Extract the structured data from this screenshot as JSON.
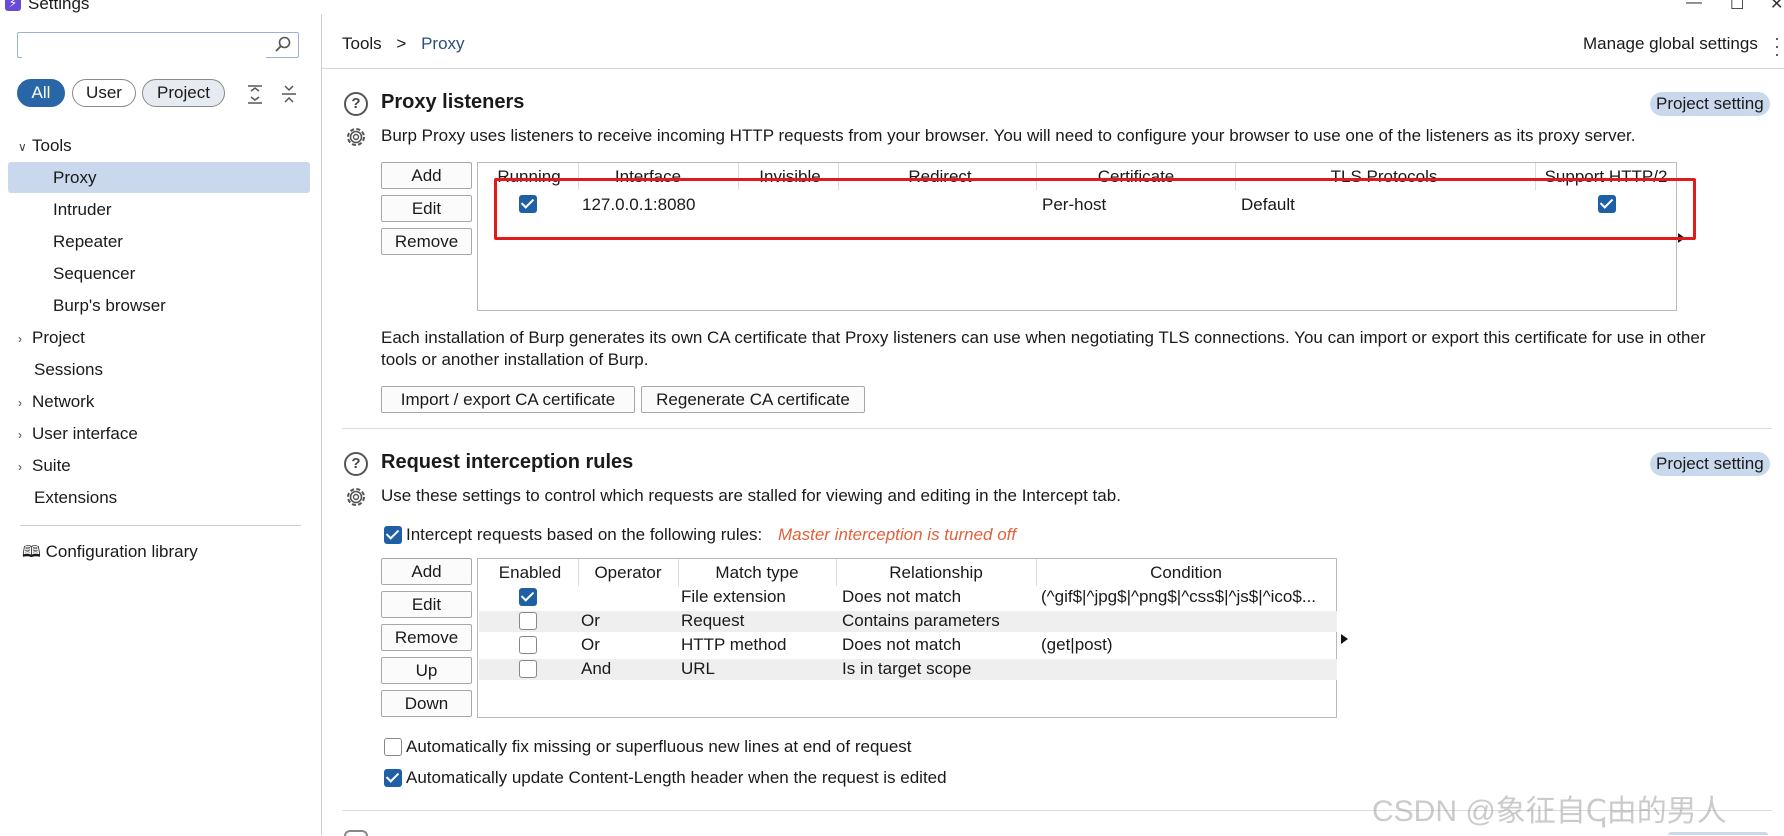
{
  "window": {
    "title": "Settings"
  },
  "sidebar": {
    "search_placeholder": "",
    "filters": [
      "All",
      "User",
      "Project"
    ],
    "items": [
      {
        "label": "Tools",
        "chevron": "v"
      },
      {
        "label": "Proxy"
      },
      {
        "label": "Intruder"
      },
      {
        "label": "Repeater"
      },
      {
        "label": "Sequencer"
      },
      {
        "label": "Burp's browser"
      },
      {
        "label": "Project",
        "chevron": ">"
      },
      {
        "label": "Sessions"
      },
      {
        "label": "Network",
        "chevron": ">"
      },
      {
        "label": "User interface",
        "chevron": ">"
      },
      {
        "label": "Suite",
        "chevron": ">"
      },
      {
        "label": "Extensions"
      }
    ],
    "config_library": "Configuration library"
  },
  "header": {
    "breadcrumb_root": "Tools",
    "breadcrumb_sep": ">",
    "breadcrumb_current": "Proxy",
    "manage_global": "Manage global settings"
  },
  "proxy_listeners": {
    "title": "Proxy listeners",
    "badge": "Project setting",
    "description": "Burp Proxy uses listeners to receive incoming HTTP requests from your browser. You will need to configure your browser to use one of the listeners as its proxy server.",
    "buttons": [
      "Add",
      "Edit",
      "Remove"
    ],
    "columns": [
      "Running",
      "Interface",
      "Invisible",
      "Redirect",
      "Certificate",
      "TLS Protocols",
      "Support HTTP/2"
    ],
    "rows": [
      {
        "running": true,
        "interface": "127.0.0.1:8080",
        "invisible": "",
        "redirect": "",
        "certificate": "Per-host",
        "tls": "Default",
        "http2": true
      }
    ],
    "ca_text_1": "Each installation of Burp generates its own CA certificate that Proxy listeners can use when negotiating TLS connections. You can import or export this certificate for use in other",
    "ca_text_2": "tools or another installation of Burp.",
    "ca_buttons": [
      "Import / export CA certificate",
      "Regenerate CA certificate"
    ]
  },
  "interception": {
    "title": "Request interception rules",
    "badge": "Project setting",
    "description": "Use these settings to control which requests are stalled for viewing and editing in the Intercept tab.",
    "intercept_label": "Intercept requests based on the following rules:",
    "intercept_checked": true,
    "master_off": "Master interception is turned off",
    "buttons": [
      "Add",
      "Edit",
      "Remove",
      "Up",
      "Down"
    ],
    "columns": [
      "Enabled",
      "Operator",
      "Match type",
      "Relationship",
      "Condition"
    ],
    "rows": [
      {
        "enabled": true,
        "operator": "",
        "match": "File extension",
        "rel": "Does not match",
        "cond": "(^gif$|^jpg$|^png$|^css$|^js$|^ico$..."
      },
      {
        "enabled": false,
        "operator": "Or",
        "match": "Request",
        "rel": "Contains parameters",
        "cond": ""
      },
      {
        "enabled": false,
        "operator": "Or",
        "match": "HTTP method",
        "rel": "Does not match",
        "cond": "(get|post)"
      },
      {
        "enabled": false,
        "operator": "And",
        "match": "URL",
        "rel": "Is in target scope",
        "cond": ""
      }
    ],
    "opt_fix_newlines": "Automatically fix missing or superfluous new lines at end of request",
    "opt_fix_newlines_checked": false,
    "opt_update_length": "Automatically update Content-Length header when the request is edited",
    "opt_update_length_checked": true
  },
  "watermark": "CSDN @象征自ↅ由的男人",
  "colors": {
    "accent": "#2866a8",
    "selection": "#c9d8ec",
    "highlight_box": "#e11b1b",
    "warning": "#e2603a"
  },
  "icons": [
    "app-icon",
    "search-icon",
    "expand-all-icon",
    "collapse-all-icon",
    "help-icon",
    "settings-gear-icon",
    "book-icon",
    "minimize-icon",
    "maximize-icon",
    "close-icon"
  ]
}
